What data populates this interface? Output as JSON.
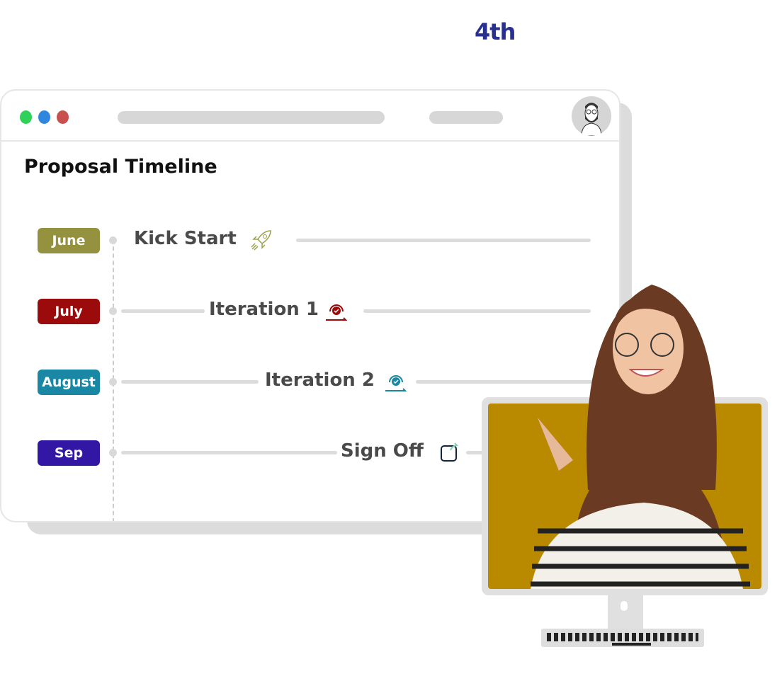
{
  "badge": "4th",
  "window": {
    "traffic_lights": [
      "#2fd158",
      "#2e86de",
      "#c8504f"
    ],
    "title": "Proposal Timeline",
    "avatar": "user-avatar-icon"
  },
  "timeline": [
    {
      "month": "June",
      "color": "#95923f",
      "label": "Kick Start",
      "icon": "rocket-icon",
      "icon_color": "#9aa04a"
    },
    {
      "month": "July",
      "color": "#9b0b0b",
      "label": "Iteration 1",
      "icon": "refresh-check-icon",
      "icon_color": "#9b0b0b"
    },
    {
      "month": "August",
      "color": "#1a87a5",
      "label": "Iteration 2",
      "icon": "refresh-check-icon",
      "icon_color": "#1a87a5"
    },
    {
      "month": "Sep",
      "color": "#3217a4",
      "label": "Sign Off",
      "icon": "share-icon",
      "icon_color": "#12263a"
    }
  ],
  "monitor": {
    "screen_color": "#b98900"
  }
}
